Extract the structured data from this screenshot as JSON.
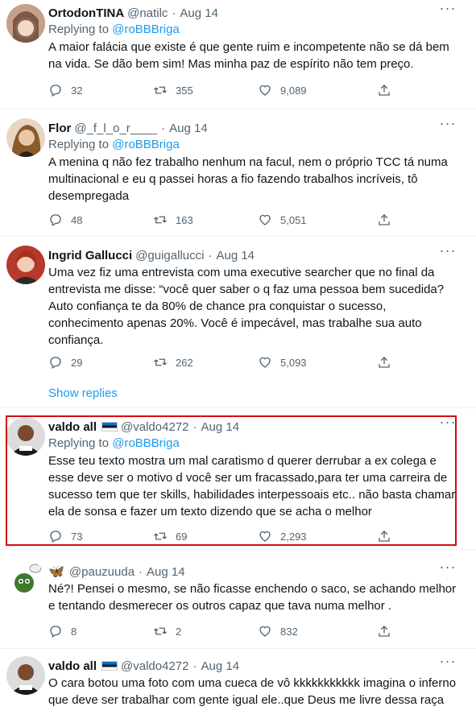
{
  "tweets": [
    {
      "name": "OrtodonTINA",
      "handle": "@natilc",
      "date": "Aug 14",
      "replying_prefix": "Replying to",
      "replying_to": "@roBBBriga",
      "text": "A maior falácia que existe é que gente ruim e incompetente não se dá bem na vida. Se dão bem sim! Mas minha paz de espírito não tem preço.",
      "replies": "32",
      "retweets": "355",
      "likes": "9,089"
    },
    {
      "name": "Flor",
      "handle": "@_f_l_o_r____",
      "date": "Aug 14",
      "replying_prefix": "Replying to",
      "replying_to": "@roBBBriga",
      "text": "A menina q não fez trabalho nenhum na facul, nem o próprio TCC tá numa multinacional e eu q passei horas a fio fazendo trabalhos incríveis, tô desempregada",
      "replies": "48",
      "retweets": "163",
      "likes": "5,051"
    },
    {
      "name": "Ingrid Gallucci",
      "handle": "@guigallucci",
      "date": "Aug 14",
      "text": "Uma vez fiz uma entrevista com uma executive searcher que no final da entrevista me disse: “você quer saber o q faz uma pessoa bem sucedida? Auto confiança te da 80% de chance pra conquistar o sucesso, conhecimento apenas 20%. Você é impecável, mas trabalhe sua auto confiança.",
      "replies": "29",
      "retweets": "262",
      "likes": "5,093"
    },
    {
      "name": "valdo all",
      "handle": "@valdo4272",
      "date": "Aug 14",
      "replying_prefix": "Replying to",
      "replying_to": "@roBBBriga",
      "text": "Esse teu texto mostra um mal caratismo d querer derrubar a ex colega e esse deve ser o motivo d você ser um fracassado,para ter uma carreira de sucesso tem que ter skills, habilidades interpessoais  etc.. não basta chamar ela de sonsa e fazer um texto dizendo que se acha o melhor",
      "replies": "73",
      "retweets": "69",
      "likes": "2,293"
    },
    {
      "name": "",
      "handle": "@pauzuuda",
      "date": "Aug 14",
      "text": "Né?! Pensei o mesmo, se não ficasse enchendo o saco, se achando melhor e tentando desmerecer os outros capaz que tava numa melhor .",
      "replies": "8",
      "retweets": "2",
      "likes": "832"
    },
    {
      "name": "valdo all",
      "handle": "@valdo4272",
      "date": "Aug 14",
      "text": "O cara botou uma foto com uma cueca de vô kkkkkkkkkkk imagina o inferno que deve ser trabalhar com gente igual ele..que Deus me livre dessa raça"
    }
  ],
  "show_replies": "Show replies",
  "colors": {
    "accent": "#1d9bf0",
    "muted": "#536471",
    "highlight_border": "#d40c14"
  }
}
